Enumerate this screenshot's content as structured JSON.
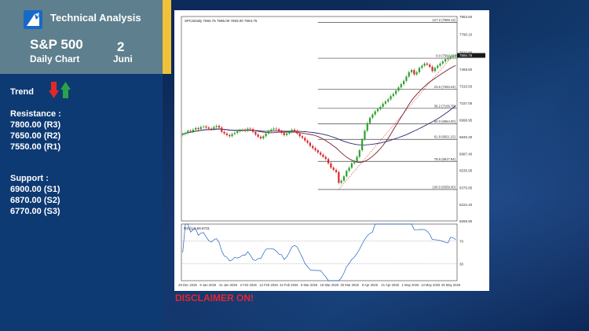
{
  "header": {
    "title": "Technical Analysis",
    "symbol": "S&P 500",
    "subtitle": "Daily Chart",
    "day": "2",
    "month": "Juni"
  },
  "trend": {
    "label": "Trend"
  },
  "resistance": {
    "label": "Resistance :",
    "levels": [
      "7800.00 (R3)",
      "7650.00 (R2)",
      "7550.00 (R1)"
    ]
  },
  "support": {
    "label": "Support :",
    "levels": [
      "6900.00 (S1)",
      "6870.00 (S2)",
      "6770.00 (S3)"
    ]
  },
  "disclaimer": "DISCLAIMER ON!",
  "colors": {
    "panel": "#0e3a73",
    "header": "#5e7f8d",
    "accent": "#f0c23a",
    "up": "#2ca02c",
    "down": "#d62728",
    "disclaimer": "#e3262e"
  },
  "chart_data": {
    "type": "candlestick",
    "info": "SPCSDaily 7594.75 7596.00 7593.00 7594.75",
    "price_ylim": [
      6068.9,
      7953.6
    ],
    "price_ticks": [
      "7953.60",
      "7790.10",
      "7622.80",
      "7468.60",
      "7310.50",
      "7157.05",
      "6998.95",
      "6845.30",
      "6687.40",
      "6535.95",
      "6375.85",
      "6222.40",
      "6068.90"
    ],
    "x_ticks": [
      "29 Dec 2025",
      "9 Jan 2026",
      "21 Jan 2026",
      "2 Feb 2026",
      "12 Feb 2026",
      "24 Feb 2026",
      "6 Mar 2026",
      "18 Mar 2026",
      "30 Mar 2026",
      "9 Apr 2026",
      "21 Apr 2026",
      "1 May 2026",
      "13 May 2026",
      "25 May 2026"
    ],
    "fibonacci": [
      {
        "label": "127.2 (7898.12)",
        "value": 7898.12
      },
      {
        "label": "0.0 (7569.00)",
        "value": 7569.0
      },
      {
        "label": "23.6 (7283.44)",
        "value": 7283.44
      },
      {
        "label": "38.2 (7106.76)",
        "value": 7106.76
      },
      {
        "label": "50.0 (6964.00)",
        "value": 6964.0
      },
      {
        "label": "61.8 (6821.22)",
        "value": 6821.22
      },
      {
        "label": "78.6 (6617.94)",
        "value": 6617.94
      },
      {
        "label": "100.0 (6359.00)",
        "value": 6359.0
      }
    ],
    "last_price": "7594.75",
    "closes": [
      6870,
      6880,
      6900,
      6895,
      6910,
      6925,
      6915,
      6935,
      6940,
      6930,
      6920,
      6915,
      6935,
      6945,
      6930,
      6890,
      6875,
      6860,
      6850,
      6870,
      6880,
      6895,
      6905,
      6910,
      6900,
      6920,
      6915,
      6890,
      6865,
      6845,
      6830,
      6850,
      6875,
      6900,
      6910,
      6920,
      6915,
      6895,
      6880,
      6860,
      6875,
      6890,
      6910,
      6900,
      6875,
      6850,
      6835,
      6810,
      6790,
      6760,
      6740,
      6720,
      6700,
      6680,
      6660,
      6640,
      6600,
      6560,
      6540,
      6520,
      6420,
      6440,
      6480,
      6530,
      6560,
      6600,
      6620,
      6660,
      6720,
      6820,
      6900,
      6970,
      7020,
      7050,
      7080,
      7100,
      7120,
      7150,
      7170,
      7190,
      7220,
      7240,
      7270,
      7300,
      7330,
      7360,
      7400,
      7440,
      7460,
      7420,
      7440,
      7480,
      7500,
      7520,
      7510,
      7490,
      7450,
      7480,
      7500,
      7520,
      7540,
      7560,
      7570,
      7580,
      7590,
      7594.75
    ],
    "rsi": {
      "label": "RSI(14) 69.9731",
      "ylim": [
        0,
        100
      ],
      "levels": [
        70,
        30
      ],
      "tick_labels": [
        "70",
        "30"
      ]
    }
  }
}
